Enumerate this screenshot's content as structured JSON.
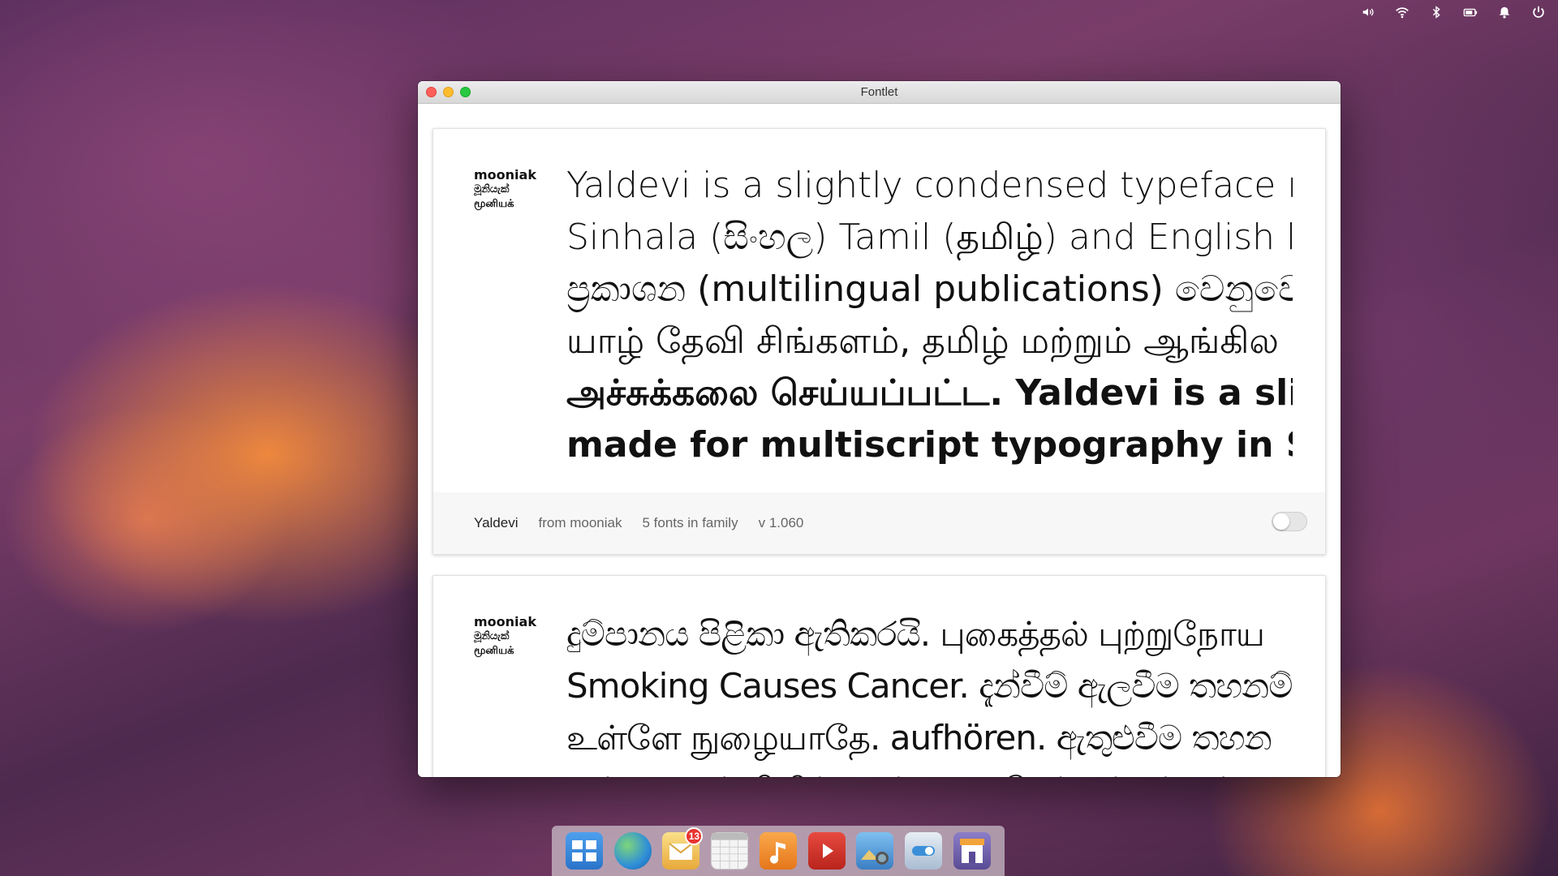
{
  "window": {
    "title": "Fontlet"
  },
  "cards": [
    {
      "foundry_logo": [
        "mooniak",
        "මූනියැක්",
        "மூனியக்"
      ],
      "sample_lines": [
        "Yaldevi is a slightly condensed typeface made",
        "Sinhala (සිංහල) Tamil (தமிழ்) and English lang",
        "ප්‍රකාශන (multilingual publications) වෙනුවෙන් ස",
        "யாழ் தேவி சிங்களம், தமிழ் மற்றும் ஆங்கில",
        "அச்சுக்கலை செய்யப்பட்ட. Yaldevi is a sligh",
        "made for multiscript typography in Sinhala"
      ],
      "family": "Yaldevi",
      "from": "from mooniak",
      "count": "5 fonts in family",
      "version": "v 1.060",
      "enabled": false
    },
    {
      "foundry_logo": [
        "mooniak",
        "මූනියැක්",
        "மூனியக்"
      ],
      "sample_lines": [
        "දුම්පානය පිළිකා ඇතිකරයි. புகைத்தல் புற்றுநோய",
        "Smoking Causes Cancer. දැන්වීම් ඇලවීම තහනම්. ஒ",
        "உள்ளே நுழையாதே. aufhören. ඇතුළුවීම තහන",
        "ஒட்டுவதும் கிழிப்பதும் தடைசெய்யப்பட்டுள்ளது"
      ]
    }
  ],
  "tray": [
    "volume-icon",
    "wifi-icon",
    "bluetooth-icon",
    "battery-icon",
    "notification-icon",
    "power-icon"
  ],
  "dock": [
    {
      "name": "multitasking-view",
      "color": "#3a8ee6"
    },
    {
      "name": "web-browser",
      "color": "#2f8fd8"
    },
    {
      "name": "mail",
      "color": "#f2c14e",
      "badge": "13"
    },
    {
      "name": "calendar",
      "color": "#e9e9e9"
    },
    {
      "name": "music",
      "color": "#f28a1e"
    },
    {
      "name": "videos",
      "color": "#d0302a"
    },
    {
      "name": "photos",
      "color": "#4a9bd9"
    },
    {
      "name": "system-settings",
      "color": "#8aa8c8"
    },
    {
      "name": "app-center",
      "color": "#6b5da8"
    }
  ]
}
